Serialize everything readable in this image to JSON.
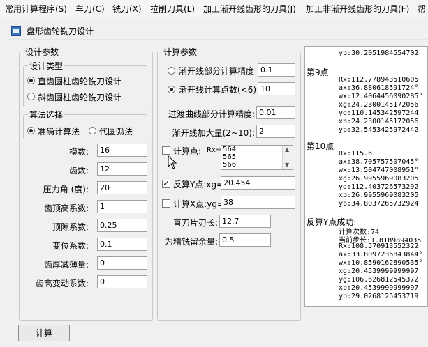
{
  "menu": [
    "常用计算程序(S)",
    "车刀(C)",
    "铣刀(X)",
    "拉削刀具(L)",
    "加工渐开线齿形的刀具(J)",
    "加工非渐开线齿形的刀具(F)",
    "帮"
  ],
  "window": {
    "title": "盘形齿轮铣刀设计"
  },
  "design_params": {
    "legend": "设计参数",
    "design_type": {
      "legend": "设计类型",
      "options": [
        "直齿圆柱齿轮铣刀设计",
        "斜齿圆柱齿轮铣刀设计"
      ],
      "selected": 0
    },
    "algorithm": {
      "legend": "算法选择",
      "options": [
        "准确计算法",
        "代圆弧法"
      ],
      "selected": 0
    },
    "fields": [
      {
        "label": "模数:",
        "value": "16"
      },
      {
        "label": "齿数:",
        "value": "12"
      },
      {
        "label": "压力角 (度):",
        "value": "20"
      },
      {
        "label": "齿顶高系数:",
        "value": "1"
      },
      {
        "label": "顶隙系数:",
        "value": "0.25"
      },
      {
        "label": "变位系数:",
        "value": "0.1"
      },
      {
        "label": "齿厚减薄量:",
        "value": "0"
      },
      {
        "label": "齿高变动系数:",
        "value": "0"
      }
    ]
  },
  "calc_params": {
    "legend": "计算参数",
    "involute_precision": {
      "label": "渐开线部分计算精度",
      "value": "0.1",
      "selected": false
    },
    "involute_points": {
      "label": "渐开线计算点数(<6)",
      "value": "10",
      "selected": true
    },
    "transition_precision": {
      "label": "过渡曲线部分计算精度:",
      "value": "0.01"
    },
    "involute_density": {
      "label": "渐开线加大量(2~10):",
      "value": "2"
    },
    "calc_point": {
      "label": "计算点:",
      "sublabel": "Rx=",
      "checked": false,
      "list": [
        "564",
        "565",
        "566"
      ]
    },
    "reverse_y": {
      "label": "反算Y点:xg=",
      "checked": true,
      "value": "20.454"
    },
    "calc_x": {
      "label": "计算X点:yg=",
      "checked": false,
      "value": "38"
    },
    "blade_length": {
      "label": "直刀片刃长:",
      "value": "12.7"
    },
    "finish_allowance": {
      "label": "为精铣留余量:",
      "value": "0.5"
    }
  },
  "output": {
    "top_line": "yb:30.2051984554702",
    "p9_title": "第9点",
    "p9_lines": [
      "Rx:112.778943510605",
      "ax:36.880618591724°",
      "wx:12.4064456090285°",
      "xg:24.2300145172056",
      "yg:110.145342597244",
      "xb:24.2300145172056",
      "yb:32.5453425972442"
    ],
    "p10_title": "第10点",
    "p10_lines": [
      "Rx:115.6",
      "ax:38.705757507045°",
      "wx:13.504747008951°",
      "xg:26.9955969083205",
      "yg:112.403726573292",
      "xb:26.9955969083205",
      "yb:34.8037265732924"
    ],
    "reverse_title": "反算Y点成功:",
    "reverse_lines": [
      "计算次数:74",
      "当前步长:1.8189894035",
      "Rx:108.570913552322",
      "ax:33.8097236843844°",
      "wx:10.8590162890535°",
      "xg:20.4539999999997",
      "yg:106.626812545372",
      "xb:20.4539999999997",
      "yb:29.0268125453719"
    ]
  },
  "buttons": {
    "calculate": "计算"
  }
}
